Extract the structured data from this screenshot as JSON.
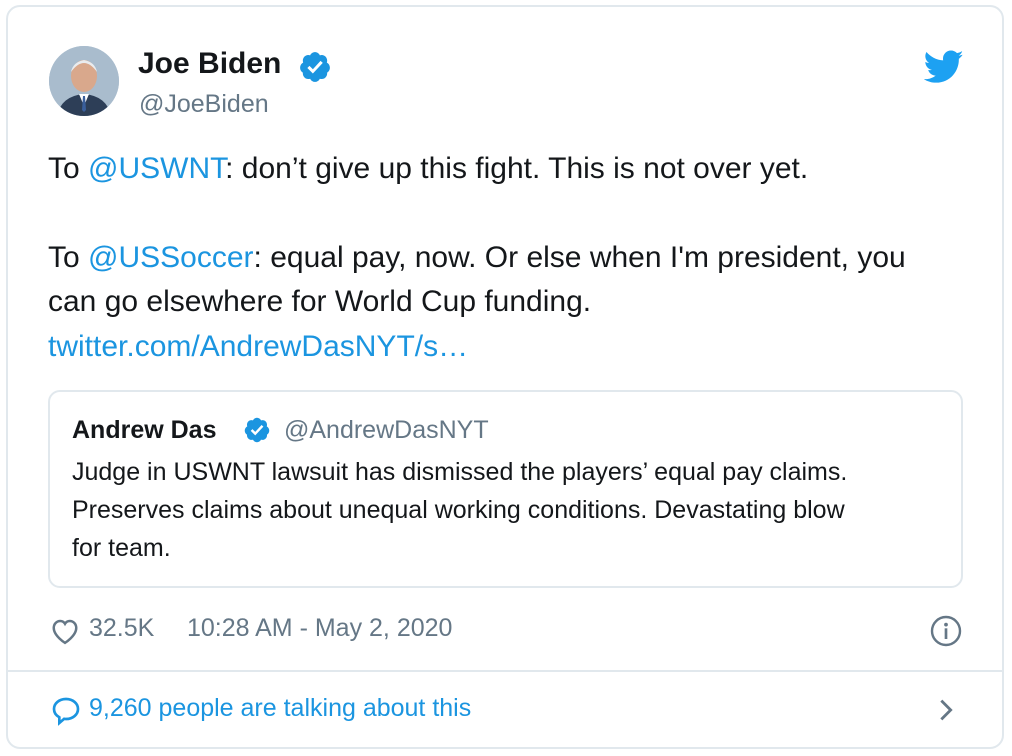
{
  "tweet": {
    "author": {
      "name": "Joe Biden",
      "handle": "@JoeBiden"
    },
    "lines": [
      {
        "prefix": "To ",
        "mention": "@USWNT",
        "rest": ": don’t give up this fight. This is not over yet."
      },
      {
        "prefix": "To ",
        "mention": "@USSoccer",
        "rest": ": equal pay, now. Or else when I'm president, you"
      }
    ],
    "line3": "can go elsewhere for World Cup funding.",
    "link": "twitter.com/AndrewDasNYT/s…",
    "quote": {
      "name": "Andrew Das",
      "handle": "@AndrewDasNYT",
      "lines": [
        "Judge in USWNT lawsuit has dismissed the players’ equal pay claims.",
        "Preserves claims about unequal working conditions. Devastating blow",
        "for team."
      ]
    },
    "likes": "32.5K",
    "timestamp": "10:28 AM - May 2, 2020",
    "talking": "9,260 people are talking about this"
  },
  "colors": {
    "accent": "#1b95e0",
    "muted": "#657786",
    "border": "#e1e8ed",
    "text": "#14171a"
  },
  "icons": [
    "verified-badge-icon",
    "twitter-bird-icon",
    "heart-icon",
    "info-icon",
    "speech-bubble-icon",
    "chevron-right-icon"
  ]
}
